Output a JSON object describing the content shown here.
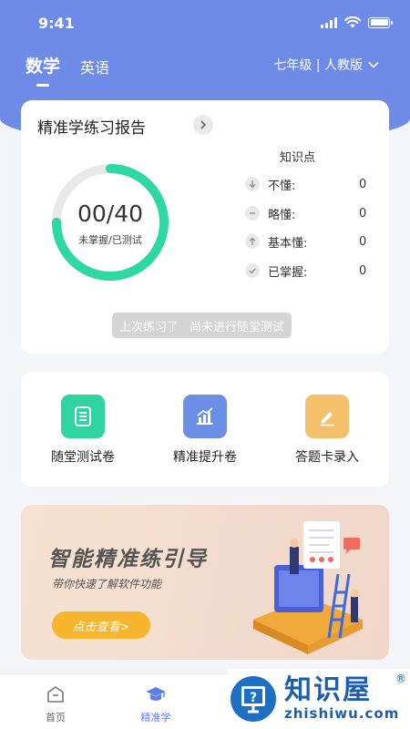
{
  "status_bar": {
    "time": "9:41"
  },
  "subjects": {
    "active": "数学",
    "other": "英语"
  },
  "grade_select": {
    "label": "七年级 | 人教版"
  },
  "report": {
    "title": "精准学练习报告",
    "progress": {
      "mastered": 0,
      "tested": 40,
      "score_text": "00/40",
      "caption": "未掌握/已测试"
    },
    "knowledge": {
      "title": "知识点",
      "rows": [
        {
          "icon": "arrow-down-icon",
          "label": "不懂:",
          "value": "0"
        },
        {
          "icon": "minus-icon",
          "label": "略懂:",
          "value": "0"
        },
        {
          "icon": "arrow-up-icon",
          "label": "基本懂:",
          "value": "0"
        },
        {
          "icon": "check-icon",
          "label": "已掌握:",
          "value": "0"
        }
      ]
    },
    "last_practice": {
      "label": "上次练习了",
      "value": "尚未进行随堂测试"
    }
  },
  "tools": [
    {
      "label": "随堂测试卷",
      "icon": "document-icon",
      "color": "#2fd4a0"
    },
    {
      "label": "精准提升卷",
      "icon": "chart-icon",
      "color": "#6b8fe4"
    },
    {
      "label": "答题卡录入",
      "icon": "pencil-icon",
      "color": "#f5c06b"
    }
  ],
  "banner": {
    "title": "智能精准练引导",
    "subtitle": "带你快速了解软件功能",
    "button": "点击查看>"
  },
  "bottom_nav": [
    {
      "label": "首页",
      "icon": "home-icon",
      "active": false
    },
    {
      "label": "精准学",
      "icon": "graduation-cap-icon",
      "active": true
    }
  ],
  "watermark": {
    "cn": "知识屋",
    "en": "zhishiwu.com",
    "reg": "®"
  },
  "colors": {
    "header": "#6f8be8",
    "ring_track": "#e8e8e8",
    "ring_progress": "#2ed8a3",
    "accent": "#5b7ee5",
    "banner_button": "#f6b52c"
  }
}
